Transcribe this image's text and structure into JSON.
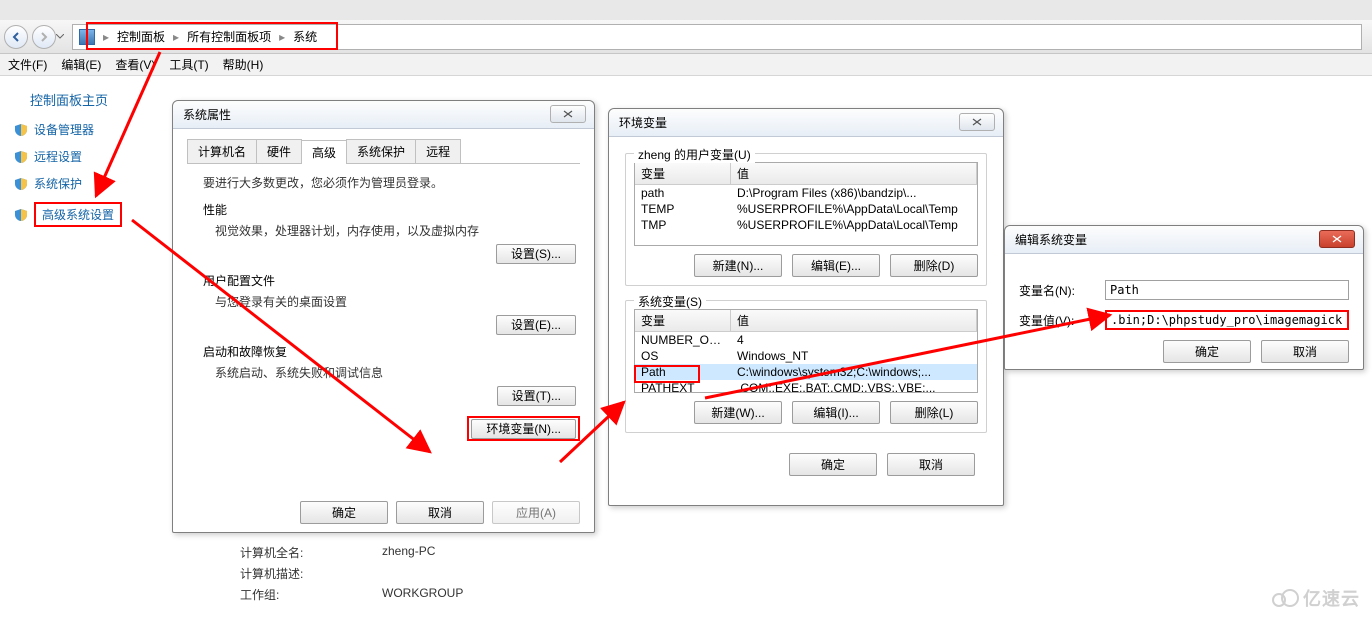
{
  "breadcrumbs": {
    "item1": "控制面板",
    "item2": "所有控制面板项",
    "item3": "系统"
  },
  "menubar": {
    "file": "文件(F)",
    "edit": "编辑(E)",
    "view": "查看(V)",
    "tools": "工具(T)",
    "help": "帮助(H)"
  },
  "sidebar": {
    "homepage": "控制面板主页",
    "device_manager": "设备管理器",
    "remote_settings": "远程设置",
    "system_protection": "系统保护",
    "advanced_system_settings": "高级系统设置"
  },
  "sysprop": {
    "title": "系统属性",
    "tabs": {
      "computer_name": "计算机名",
      "hardware": "硬件",
      "advanced": "高级",
      "system_protection": "系统保护",
      "remote": "远程"
    },
    "admin_note": "要进行大多数更改，您必须作为管理员登录。",
    "performance_header": "性能",
    "performance_desc": "视觉效果，处理器计划，内存使用，以及虚拟内存",
    "profiles_header": "用户配置文件",
    "profiles_desc": "与您登录有关的桌面设置",
    "startup_header": "启动和故障恢复",
    "startup_desc": "系统启动、系统失败和调试信息",
    "settings_s": "设置(S)...",
    "settings_e": "设置(E)...",
    "settings_t": "设置(T)...",
    "env_vars_btn": "环境变量(N)...",
    "ok": "确定",
    "cancel": "取消",
    "apply": "应用(A)"
  },
  "env": {
    "title": "环境变量",
    "user_group": "zheng 的用户变量(U)",
    "sys_group": "系统变量(S)",
    "col_var": "变量",
    "col_value": "值",
    "user_vars": [
      {
        "name": "path",
        "value": "D:\\Program Files (x86)\\bandzip\\..."
      },
      {
        "name": "TEMP",
        "value": "%USERPROFILE%\\AppData\\Local\\Temp"
      },
      {
        "name": "TMP",
        "value": "%USERPROFILE%\\AppData\\Local\\Temp"
      }
    ],
    "sys_vars": [
      {
        "name": "NUMBER_OF_PR...",
        "value": "4"
      },
      {
        "name": "OS",
        "value": "Windows_NT"
      },
      {
        "name": "Path",
        "value": "C:\\windows\\system32;C:\\windows;..."
      },
      {
        "name": "PATHEXT",
        "value": ".COM;.EXE;.BAT;.CMD;.VBS;.VBE;..."
      }
    ],
    "new_n": "新建(N)...",
    "edit_e": "编辑(E)...",
    "del_d": "删除(D)",
    "new_w": "新建(W)...",
    "edit_i": "编辑(I)...",
    "del_l": "删除(L)",
    "ok": "确定",
    "cancel": "取消"
  },
  "editvar": {
    "title": "编辑系统变量",
    "name_label": "变量名(N):",
    "name_value": "Path",
    "value_label": "变量值(V):",
    "value_value": ".bin;D:\\phpstudy_pro\\imagemagick\\bin",
    "ok": "确定",
    "cancel": "取消"
  },
  "bginfo": {
    "full_name_label": "计算机全名:",
    "full_name_value": "zheng-PC",
    "desc_label": "计算机描述:",
    "desc_value": "",
    "workgroup_label": "工作组:",
    "workgroup_value": "WORKGROUP"
  },
  "watermark": "亿速云"
}
